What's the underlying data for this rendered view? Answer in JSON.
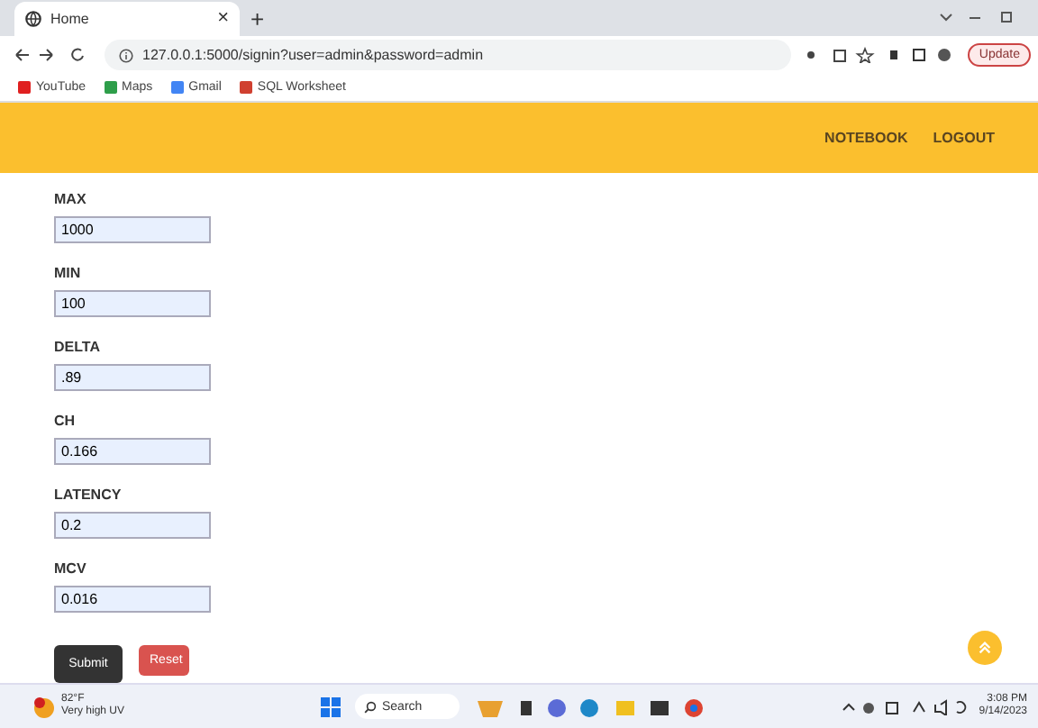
{
  "browser": {
    "tab_title": "Home",
    "close": "×",
    "new_tab": "+",
    "url": "127.0.0.1:5000/signin?user=admin&password=admin",
    "update": "Update",
    "bookmarks": [
      {
        "label": "YouTube",
        "color": "#e02020"
      },
      {
        "label": "Maps",
        "color": "#2e9e4a"
      },
      {
        "label": "Gmail",
        "color": "#4285f4"
      },
      {
        "label": "SQL Worksheet",
        "color": "#d04030"
      }
    ]
  },
  "navbar": {
    "links": [
      "NOTEBOOK",
      "LOGOUT"
    ]
  },
  "form": {
    "fields": [
      {
        "label": "MAX",
        "value": "1000"
      },
      {
        "label": "MIN",
        "value": "100"
      },
      {
        "label": "DELTA",
        "value": ".89"
      },
      {
        "label": "CH",
        "value": "0.166"
      },
      {
        "label": "LATENCY",
        "value": "0.2"
      },
      {
        "label": "MCV",
        "value": "0.016"
      }
    ],
    "buttons": [
      {
        "label": "Submit",
        "kind": "primary"
      },
      {
        "label": "Reset",
        "kind": "danger"
      }
    ]
  },
  "taskbar": {
    "temperature": "82°F",
    "weather": "Very high UV",
    "search": "Search",
    "time": "3:08 PM",
    "date": "9/14/2023"
  }
}
